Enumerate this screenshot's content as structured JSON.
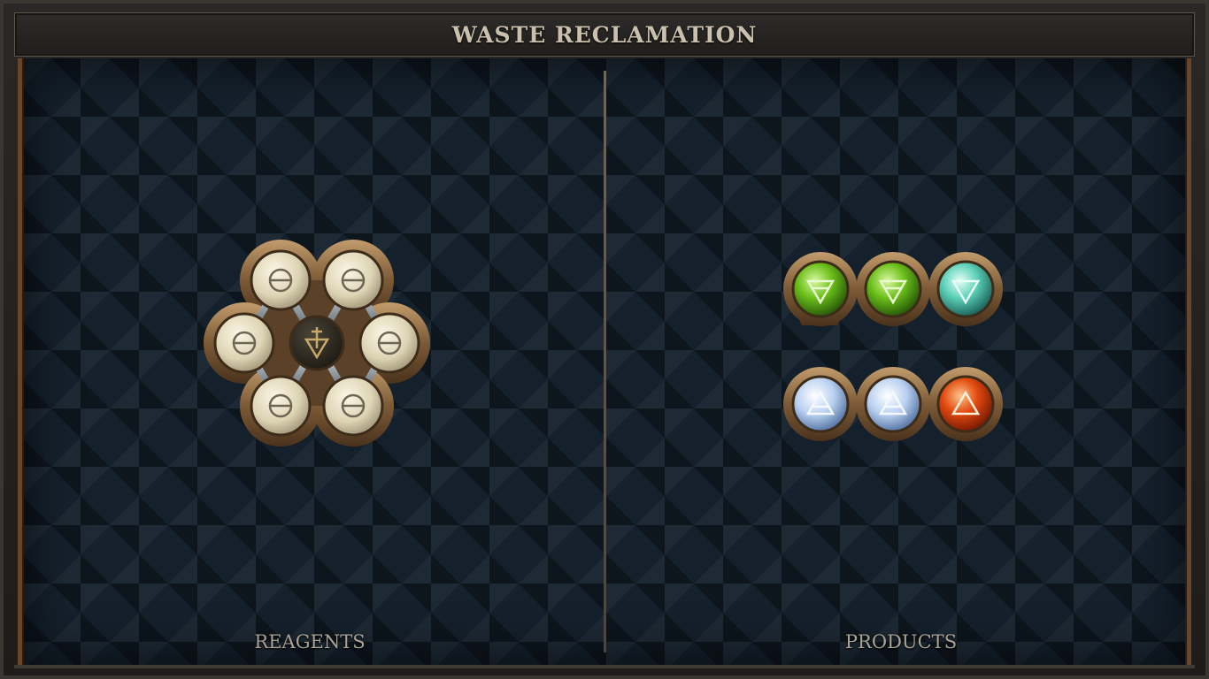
{
  "title": "WASTE RECLAMATION",
  "reagents": {
    "label": "REAGENTS",
    "center_symbol": "lead-icon",
    "outer_symbol": "salt-icon",
    "outer_count": 6
  },
  "products": {
    "label": "PRODUCTS",
    "rows": [
      {
        "elements": [
          "earth",
          "earth",
          "water"
        ]
      },
      {
        "elements": [
          "air",
          "air",
          "fire"
        ]
      }
    ]
  },
  "colors": {
    "salt": "#e8e1c9",
    "lead": "#2f2b24",
    "earth": "#6cbf1a",
    "water": "#5cd1b8",
    "air": "#c9dcf2",
    "fire": "#e24a10",
    "bronze": "#8a6a44",
    "board": "#14202c"
  }
}
